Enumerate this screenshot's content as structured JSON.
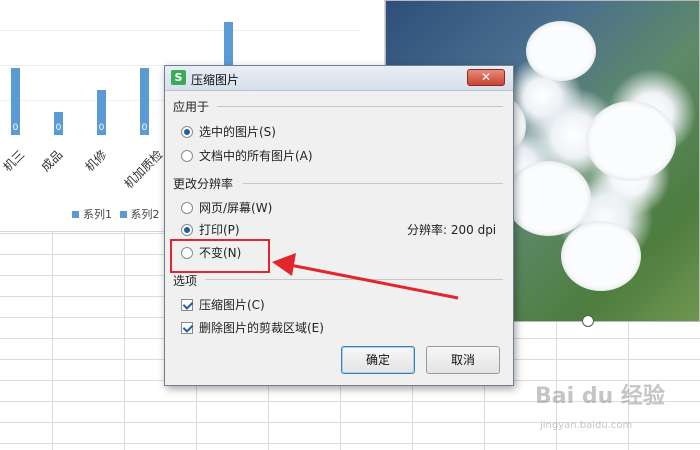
{
  "chart": {
    "categories": [
      "机三",
      "成品",
      "机修",
      "机加质检"
    ],
    "values": [
      "0",
      "0",
      "0",
      "0"
    ],
    "extra_bar_value": "0",
    "legend": [
      "系列1",
      "系列2"
    ],
    "series_color": "#5b9bd5"
  },
  "dialog": {
    "title": "压缩图片",
    "icon_letter": "S",
    "close_icon": "✕",
    "apply_to": {
      "label": "应用于",
      "options": [
        "选中的图片(S)",
        "文档中的所有图片(A)"
      ],
      "selected": 0
    },
    "resolution": {
      "label": "更改分辨率",
      "options": [
        "网页/屏幕(W)",
        "打印(P)",
        "不变(N)"
      ],
      "selected": 1,
      "dpi_text": "分辨率:  200 dpi"
    },
    "options": {
      "label": "选项",
      "checkboxes": [
        "压缩图片(C)",
        "删除图片的剪裁区域(E)"
      ],
      "checked": [
        true,
        true
      ]
    },
    "ok_label": "确定",
    "cancel_label": "取消"
  },
  "annotation": {
    "color": "#e2262c"
  },
  "watermark": {
    "main": "Bai du 经验",
    "sub": "jingyan.baidu.com"
  }
}
